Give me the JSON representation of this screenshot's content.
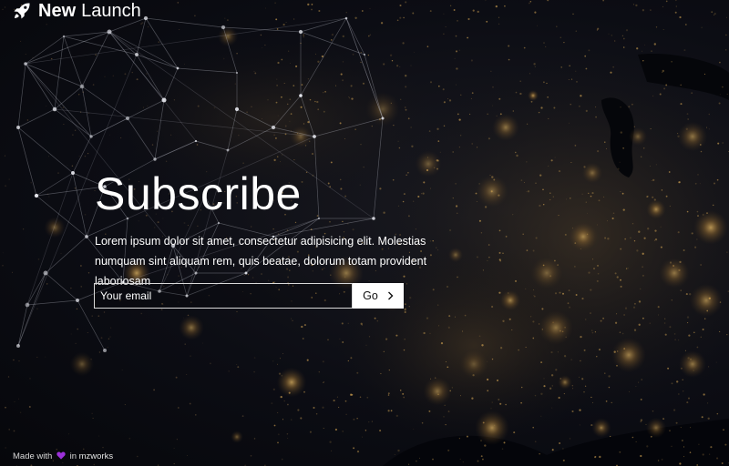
{
  "header": {
    "logo_icon": "rocket-icon",
    "brand_bold": "New",
    "brand_light": "Launch"
  },
  "hero": {
    "title": "Subscribe",
    "lead": "Lorem ipsum dolor sit amet, consectetur adipisicing elit. Molestias numquam sint aliquam rem, quis beatae, dolorum totam provident laboriosam"
  },
  "form": {
    "email_placeholder": "Your email",
    "submit_label": "Go",
    "submit_icon": "chevron-right-icon"
  },
  "footer": {
    "made_with": "Made with",
    "heart_icon": "heart-icon",
    "in_text": "in",
    "author": "mzworks"
  },
  "colors": {
    "background": "#07080d",
    "text": "#ffffff",
    "heart": "#9b30d9",
    "city_lights": "#e8b24a"
  }
}
